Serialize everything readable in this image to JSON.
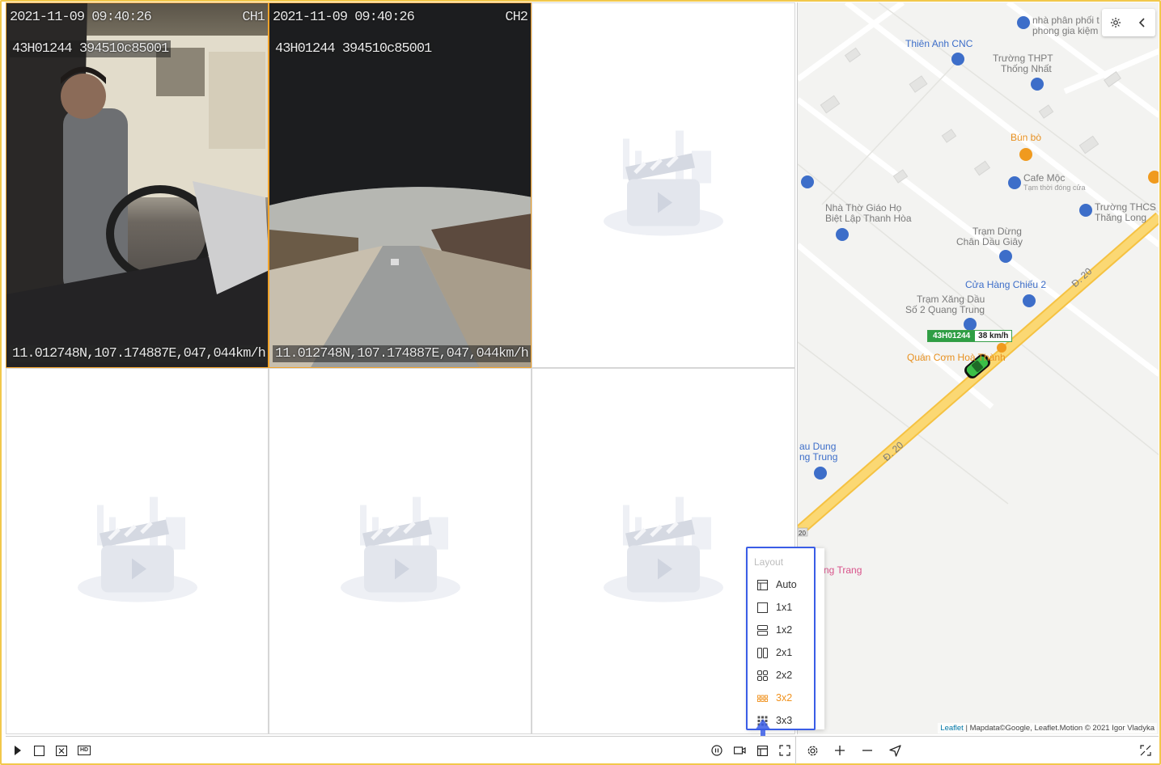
{
  "cameras": [
    {
      "timestamp": "2021-11-09 09:40:26",
      "channel": "CH1",
      "device_id": "43H01244 394510c85001",
      "gps": "11.012748N,107.174887E,047,044km/h"
    },
    {
      "timestamp": "2021-11-09 09:40:26",
      "channel": "CH2",
      "device_id": "43H01244 394510c85001",
      "gps": "11.012748N,107.174887E,047,044km/h"
    }
  ],
  "map": {
    "labels": {
      "nha_phan_phoi_1": "nhà phân phối t",
      "nha_phan_phoi_2": "phong gia kiệm",
      "thien_anh": "Thiên Anh CNC",
      "truong_thpt_1": "Trường THPT",
      "truong_thpt_2": "Thống Nhất",
      "bun_bo": "Bún bò",
      "cafe_moc": "Cafe Mộc",
      "cafe_moc_sub": "Tạm thời đóng cửa",
      "nha_tho_1": "Nhà Thờ Giáo Họ",
      "nha_tho_2": "Biệt Lập Thanh Hòa",
      "truong_thcs_1": "Trường THCS",
      "truong_thcs_2": "Thăng Long",
      "tram_dung_1": "Trạm Dừng",
      "tram_dung_2": "Chân Dầu Giây",
      "cua_hang": "Cửa Hàng Chiếu 2",
      "tram_xang_1": "Trạm Xăng Dầu",
      "tram_xang_2": "Số 2 Quang Trung",
      "quan_com": "Quán Cơm Hoà   Thành",
      "road_1": "Đ. 20",
      "road_2": "Đ. 20",
      "rau_dung_1": "au Dung",
      "rau_dung_2": "ng Trung",
      "ng_trang": "ng Trang",
      "road_badge": "20"
    },
    "vehicle": {
      "plate": "43H01244",
      "speed": "38 km/h"
    },
    "attribution_leaflet": "Leaflet",
    "attribution_rest": " | Mapdata©Google, Leaflet.Motion © 2021 Igor Vladyka",
    "controls": {
      "settings_icon": "gear-icon",
      "collapse_icon": "chevron-left-icon"
    }
  },
  "layout_menu": {
    "title": "Layout",
    "items": [
      {
        "label": "Auto",
        "icon": "layout-auto-icon"
      },
      {
        "label": "1x1",
        "icon": "layout-1x1-icon"
      },
      {
        "label": "1x2",
        "icon": "layout-1x2-icon"
      },
      {
        "label": "2x1",
        "icon": "layout-2x1-icon"
      },
      {
        "label": "2x2",
        "icon": "layout-2x2-icon"
      },
      {
        "label": "3x2",
        "icon": "layout-3x2-icon"
      },
      {
        "label": "3x3",
        "icon": "layout-3x3-icon"
      }
    ],
    "selected": "3x2"
  },
  "colors": {
    "accent": "#f0911c",
    "frame": "#f2c84b",
    "highlight": "#3a5de6",
    "vehicle": "#2f9e44",
    "road": "#f7c948"
  },
  "toolbar": {
    "left_icons": [
      "play-icon",
      "stop-icon",
      "close-all-icon",
      "hd-icon"
    ],
    "hd_label": "HD",
    "right_icons": [
      "info-icon",
      "record-icon",
      "layout-icon",
      "fullscreen-icon"
    ],
    "map_icons": [
      "gear-icon",
      "zoom-in-icon",
      "zoom-out-icon",
      "locate-icon",
      "expand-icon"
    ]
  }
}
